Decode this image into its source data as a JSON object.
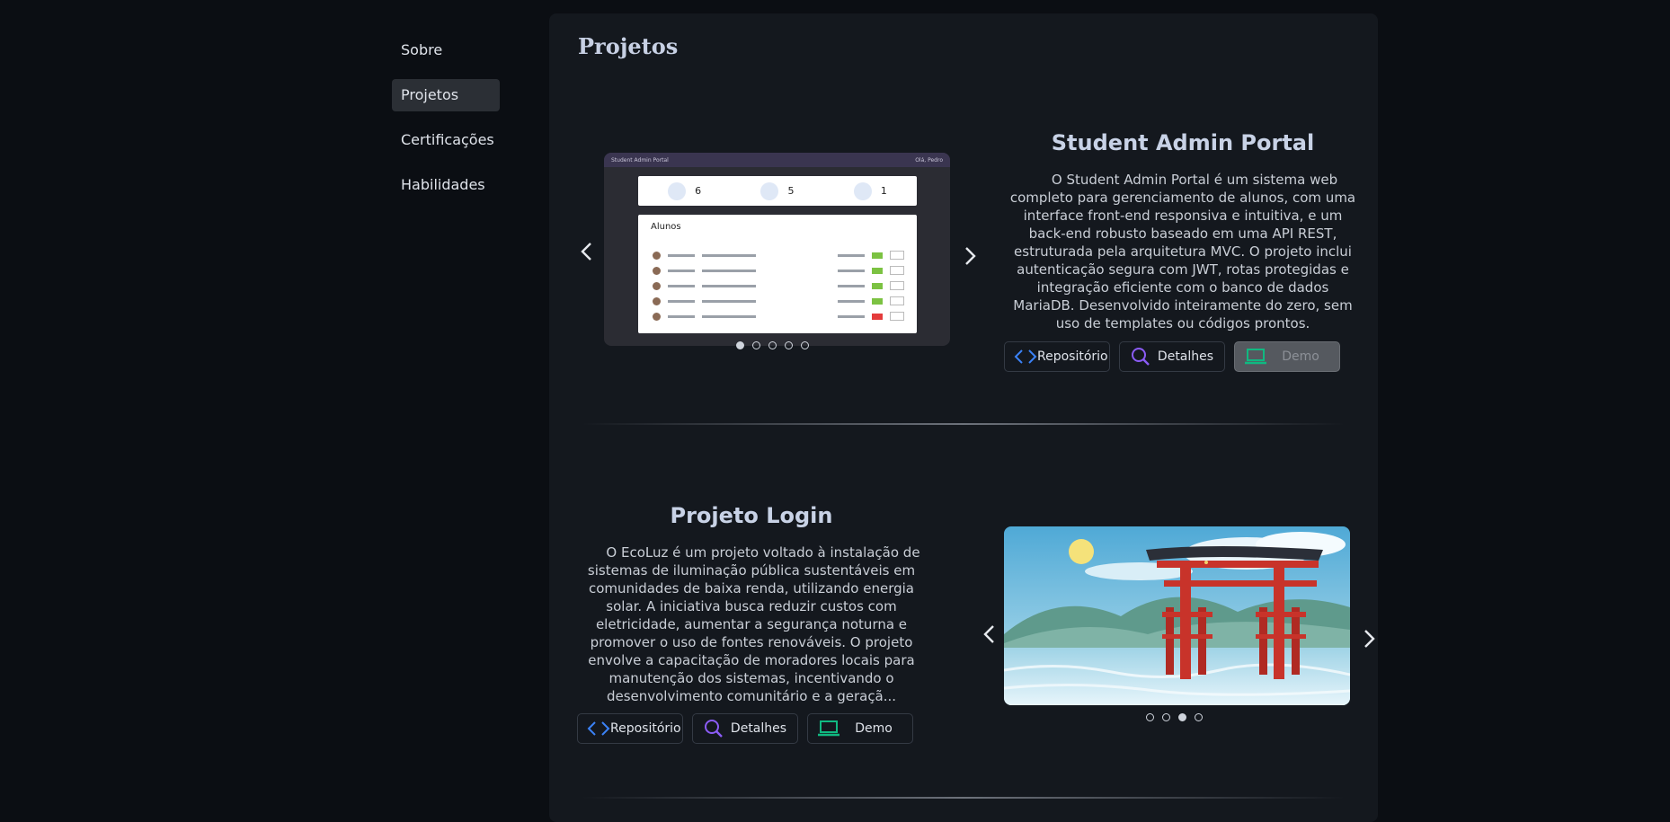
{
  "sidebar": {
    "items": [
      {
        "label": "Sobre",
        "active": false
      },
      {
        "label": "Projetos",
        "active": true
      },
      {
        "label": "Certificações",
        "active": false
      },
      {
        "label": "Habilidades",
        "active": false
      }
    ]
  },
  "main": {
    "section_title": "Projetos",
    "projects": [
      {
        "title": "Student Admin Portal",
        "description": "O Student Admin Portal é um sistema web completo para gerenciamento de alunos, com uma interface front-end responsiva e intuitiva, e um back-end robusto baseado em uma API REST, estruturada pela arquitetura MVC. O projeto inclui autenticação segura com JWT, rotas protegidas e integração eficiente com o banco de dados MariaDB. Desenvolvido inteiramente do zero, sem uso de templates ou códigos prontos.",
        "buttons": {
          "repo": "Repositório",
          "details": "Detalhes",
          "demo": "Demo"
        },
        "demo_disabled": true,
        "carousel": {
          "slides": 5,
          "active_index": 0
        },
        "mock": {
          "app_title": "Student Admin Portal",
          "user_label": "Olá, Pedro",
          "stats": [
            "6",
            "5",
            "1"
          ],
          "table_title": "Alunos"
        }
      },
      {
        "title": "Projeto Login",
        "description": "O EcoLuz é um projeto voltado à instalação de sistemas de iluminação pública sustentáveis em comunidades de baixa renda, utilizando energia solar. A iniciativa busca reduzir custos com eletricidade, aumentar a segurança noturna e promover o uso de fontes renováveis. O projeto envolve a capacitação de moradores locais para manutenção dos sistemas, incentivando o desenvolvimento comunitário e a geraçã...",
        "buttons": {
          "repo": "Repositório",
          "details": "Detalhes",
          "demo": "Demo"
        },
        "demo_disabled": false,
        "carousel": {
          "slides": 4,
          "active_index": 2
        }
      }
    ]
  },
  "colors": {
    "background": "#0b0e13",
    "panel": "#14181e",
    "repo_icon": "#3b82f6",
    "details_icon": "#8b5cf6",
    "demo_icon": "#10b981"
  },
  "icons": {
    "repo": "code-icon",
    "details": "search-icon",
    "demo": "laptop-icon",
    "prev": "chevron-left-icon",
    "next": "chevron-right-icon"
  }
}
